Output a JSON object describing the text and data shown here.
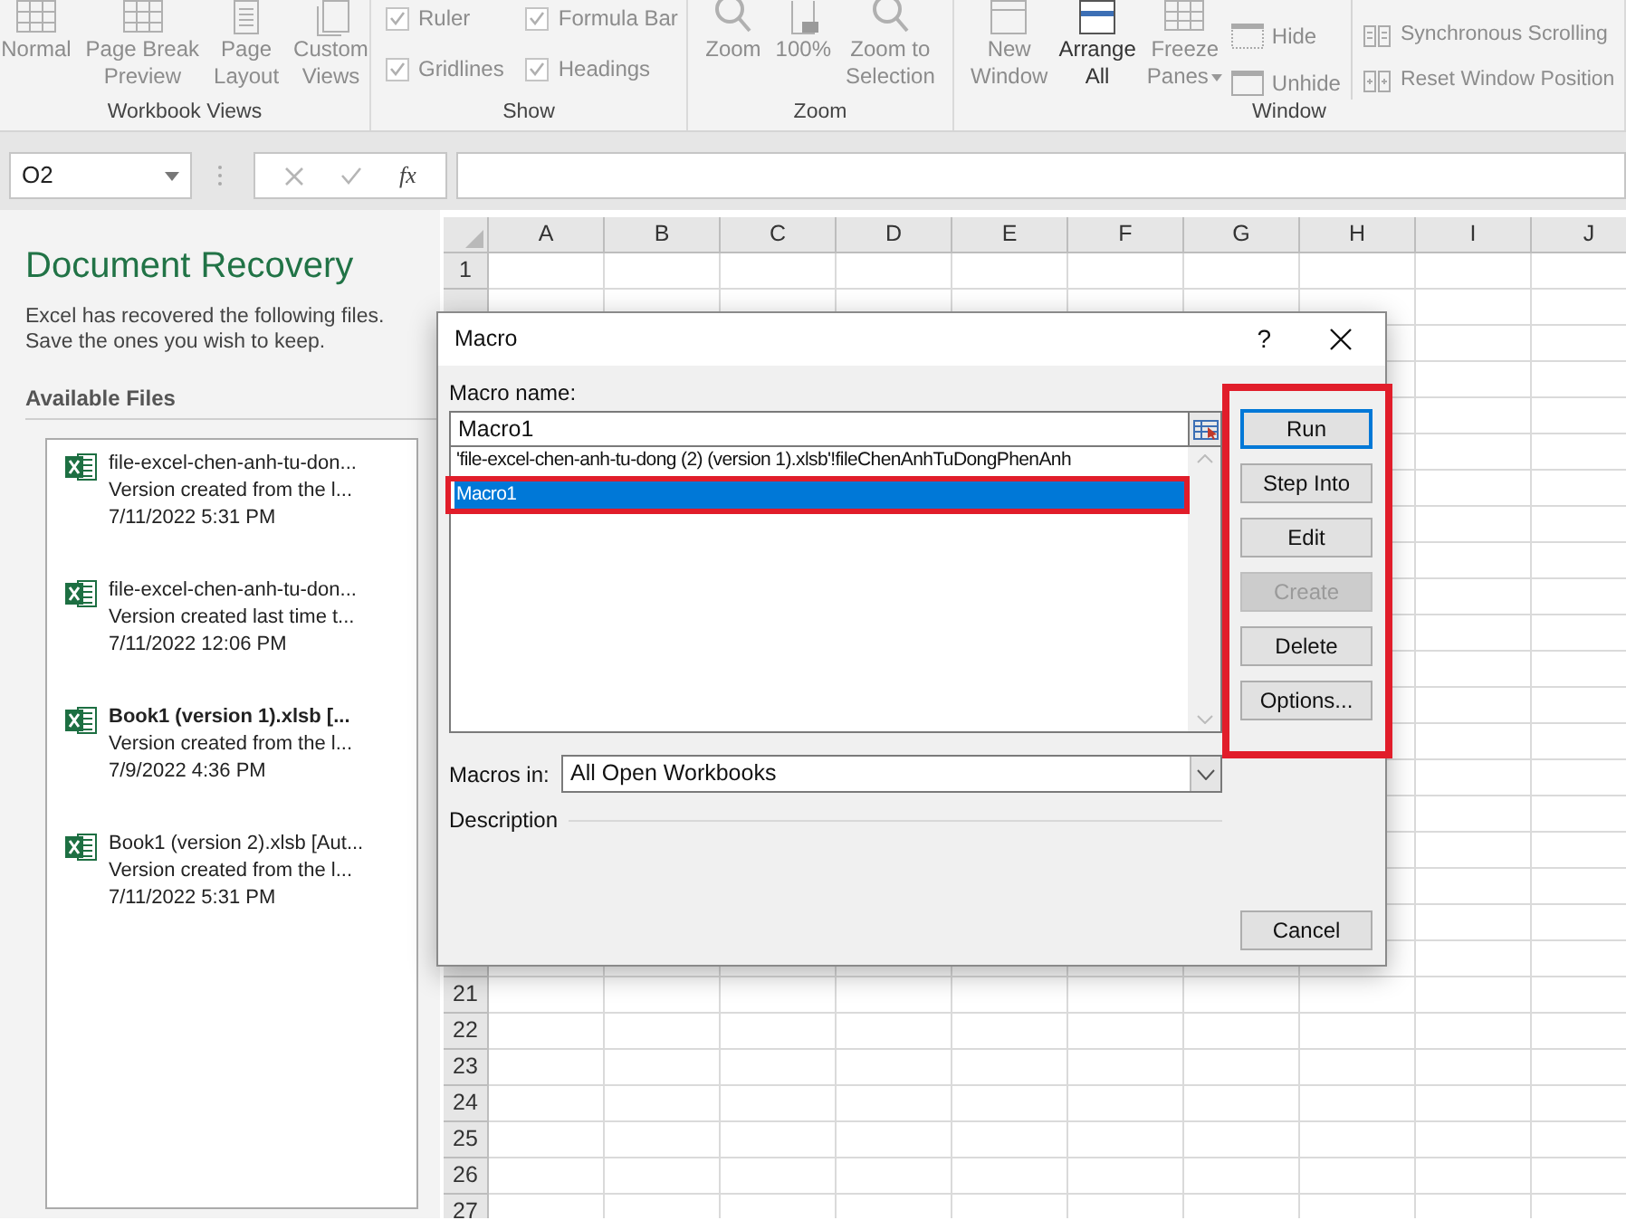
{
  "ribbon": {
    "groups": [
      {
        "label": "Workbook Views",
        "kind": "buttons",
        "items": [
          {
            "lines": [
              "Normal"
            ],
            "disabled": true
          },
          {
            "lines": [
              "Page Break",
              "Preview"
            ],
            "disabled": true
          },
          {
            "lines": [
              "Page",
              "Layout"
            ],
            "disabled": true
          },
          {
            "lines": [
              "Custom",
              "Views"
            ],
            "disabled": true
          }
        ]
      },
      {
        "label": "Show",
        "kind": "checkboxes",
        "items": [
          {
            "label": "Ruler",
            "checked": true,
            "disabled": true
          },
          {
            "label": "Formula Bar",
            "checked": true,
            "disabled": true
          },
          {
            "label": "Gridlines",
            "checked": true,
            "disabled": true
          },
          {
            "label": "Headings",
            "checked": true,
            "disabled": true
          }
        ]
      },
      {
        "label": "Zoom",
        "kind": "buttons",
        "items": [
          {
            "lines": [
              "Zoom"
            ],
            "disabled": true
          },
          {
            "lines": [
              "100%"
            ],
            "disabled": true
          },
          {
            "lines": [
              "Zoom to",
              "Selection"
            ],
            "disabled": true
          }
        ]
      },
      {
        "label": "Window",
        "kind": "window",
        "items": [
          {
            "lines": [
              "New",
              "Window"
            ],
            "disabled": true
          },
          {
            "lines": [
              "Arrange",
              "All"
            ],
            "disabled": false
          },
          {
            "lines": [
              "Freeze",
              "Panes"
            ],
            "disabled": true,
            "has_menu": true
          }
        ],
        "small_items": [
          {
            "label": "Hide",
            "disabled": true
          },
          {
            "label": "Unhide",
            "disabled": true
          }
        ],
        "side_items": [
          {
            "label": "Synchronous Scrolling",
            "disabled": true
          },
          {
            "label": "Reset Window Position",
            "disabled": true
          }
        ]
      }
    ]
  },
  "formula_bar": {
    "name_box": "O2",
    "function_label": "fx"
  },
  "recovery": {
    "title": "Document Recovery",
    "description": "Excel has recovered the following files. Save the ones you wish to keep.",
    "files_heading": "Available Files",
    "files": [
      {
        "name": "file-excel-chen-anh-tu-don...",
        "note": "Version created from the l...",
        "time": "7/11/2022 5:31 PM",
        "bold": false
      },
      {
        "name": "file-excel-chen-anh-tu-don...",
        "note": "Version created last time t...",
        "time": "7/11/2022 12:06 PM",
        "bold": false
      },
      {
        "name": "Book1 (version 1).xlsb  [...",
        "note": "Version created from the l...",
        "time": "7/9/2022 4:36 PM",
        "bold": true
      },
      {
        "name": "Book1 (version 2).xlsb  [Aut...",
        "note": "Version created from the l...",
        "time": "7/11/2022 5:31 PM",
        "bold": false
      }
    ]
  },
  "sheet": {
    "columns": [
      "A",
      "B",
      "C",
      "D",
      "E",
      "F",
      "G",
      "H",
      "I",
      "J"
    ],
    "top_rows": [
      "1"
    ],
    "bottom_rows": [
      "21",
      "22",
      "23",
      "24",
      "25",
      "26",
      "27"
    ]
  },
  "dialog": {
    "title": "Macro",
    "help": "?",
    "name_label": "Macro name:",
    "name_value": "Macro1",
    "macros": [
      {
        "text": "'file-excel-chen-anh-tu-dong (2) (version 1).xlsb'!fileChenAnhTuDongPhenAnh",
        "selected": false
      },
      {
        "text": "Macro1",
        "selected": true
      }
    ],
    "buttons": [
      {
        "label": "Run",
        "default": true,
        "disabled": false
      },
      {
        "label": "Step Into",
        "default": false,
        "disabled": false
      },
      {
        "label": "Edit",
        "default": false,
        "disabled": false
      },
      {
        "label": "Create",
        "default": false,
        "disabled": true
      },
      {
        "label": "Delete",
        "default": false,
        "disabled": false
      },
      {
        "label": "Options...",
        "default": false,
        "disabled": false
      }
    ],
    "macros_in_label": "Macros in:",
    "macros_in_value": "All Open Workbooks",
    "description_label": "Description",
    "cancel": "Cancel"
  },
  "annotations": {
    "selected_macro_frame": true,
    "buttons_frame": true
  }
}
